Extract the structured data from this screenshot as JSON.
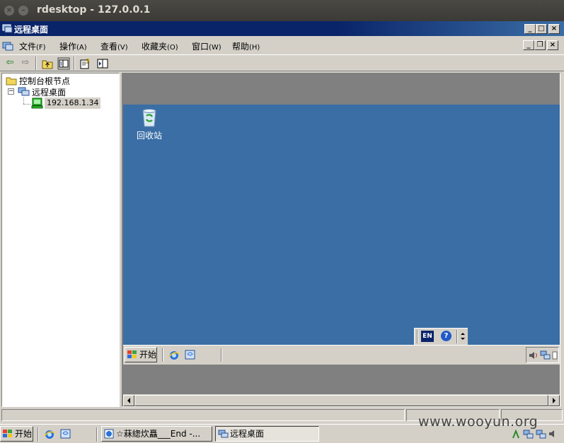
{
  "host_window": {
    "title": "rdesktop - 127.0.0.1",
    "close_glyph": "×",
    "minimize_glyph": "–"
  },
  "mmc": {
    "title": "远程桌面",
    "caption_buttons": {
      "minimize": "_",
      "maximize": "□",
      "close": "×"
    },
    "mdi_buttons": {
      "minimize": "_",
      "restore": "❐",
      "close": "×"
    },
    "menu": [
      {
        "label": "文件",
        "accel": "(F)"
      },
      {
        "label": "操作",
        "accel": "(A)"
      },
      {
        "label": "查看",
        "accel": "(V)"
      },
      {
        "label": "收藏夹",
        "accel": "(O)"
      },
      {
        "label": "窗口",
        "accel": "(W)"
      },
      {
        "label": "帮助",
        "accel": "(H)"
      }
    ],
    "toolbar": {
      "back_glyph": "⇦",
      "forward_glyph": "⇨"
    },
    "tree": {
      "root": "控制台根节点",
      "expander": "−",
      "group": "远程桌面",
      "connection": "192.168.1.34"
    }
  },
  "remote": {
    "desktop_icon": "回收站",
    "lang_indicator": "EN",
    "help_glyph": "?",
    "start_label": "开始"
  },
  "host_taskbar": {
    "start_label": "开始",
    "tasks": [
      {
        "label": "☆菻緫炊矗___End -..."
      },
      {
        "label": "远程桌面"
      }
    ]
  },
  "watermark": "www.wooyun.org",
  "icons": {
    "app": "mmc-icon",
    "folder": "folder-icon",
    "computer": "computer-icon",
    "recycle": "recycle-bin-icon",
    "ie": "ie-icon",
    "help": "help-icon"
  },
  "colors": {
    "desktop": "#3a6ea5",
    "titlebar": "#0a246a",
    "host_titlebar": "#3b3a36"
  }
}
